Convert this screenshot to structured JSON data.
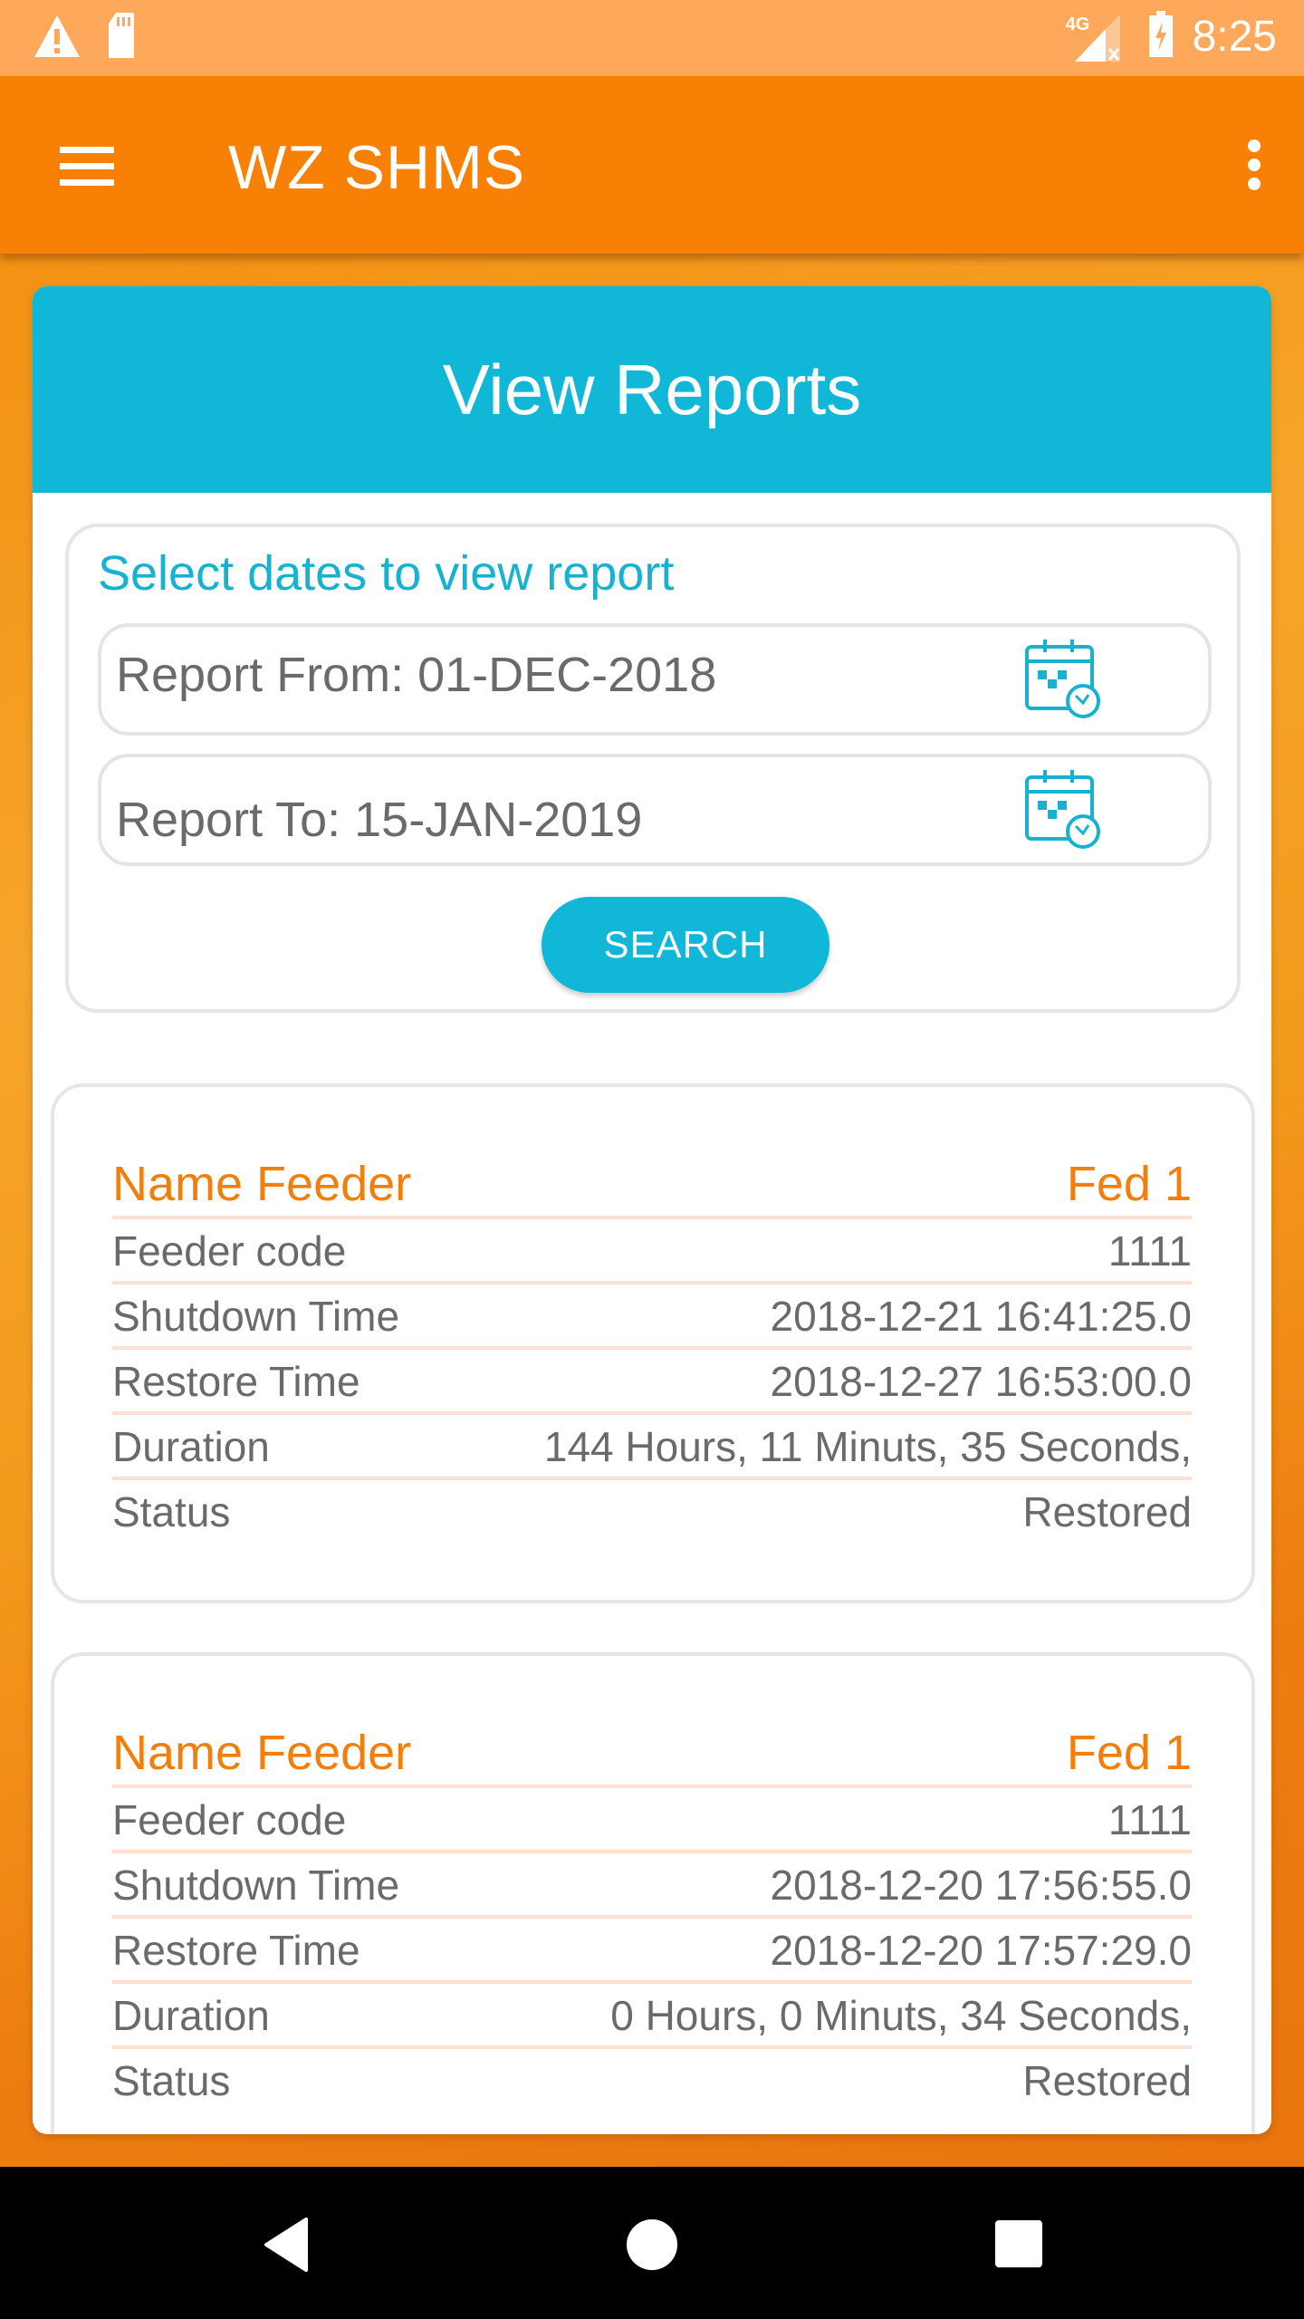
{
  "status_bar": {
    "left_icons": [
      "warning-icon",
      "sd-card-icon"
    ],
    "network_label": "4G",
    "right_icons": [
      "signal-no-data-icon",
      "battery-charging-icon"
    ],
    "time": "8:25"
  },
  "app_bar": {
    "title": "WZ SHMS",
    "menu_icon": "hamburger-menu-icon",
    "overflow_icon": "more-vert-icon"
  },
  "page": {
    "header": "View Reports",
    "date_panel": {
      "title": "Select dates to view report",
      "from_field": "Report From: 01-DEC-2018",
      "to_field": "Report To: 15-JAN-2019",
      "calendar_icon": "calendar-clock-icon",
      "search_label": "SEARCH"
    },
    "reports": [
      {
        "header_label": "Name Feeder",
        "header_value": "Fed 1",
        "rows": [
          {
            "label": "Feeder code",
            "value": "1111"
          },
          {
            "label": "Shutdown Time",
            "value": "2018-12-21 16:41:25.0"
          },
          {
            "label": "Restore Time",
            "value": "2018-12-27 16:53:00.0"
          },
          {
            "label": "Duration",
            "value": "144 Hours, 11 Minuts, 35 Seconds,"
          },
          {
            "label": "Status",
            "value": "Restored"
          }
        ]
      },
      {
        "header_label": "Name Feeder",
        "header_value": "Fed 1",
        "rows": [
          {
            "label": "Feeder code",
            "value": "1111"
          },
          {
            "label": "Shutdown Time",
            "value": "2018-12-20 17:56:55.0"
          },
          {
            "label": "Restore Time",
            "value": "2018-12-20 17:57:29.0"
          },
          {
            "label": "Duration",
            "value": "0 Hours, 0 Minuts, 34 Seconds,"
          },
          {
            "label": "Status",
            "value": "Restored"
          }
        ]
      }
    ]
  },
  "nav_bar": {
    "back_icon": "back-icon",
    "home_icon": "home-icon",
    "recents_icon": "recents-icon"
  },
  "colors": {
    "app_bar": "#f88004",
    "status_bar": "#fda85a",
    "accent_cyan": "#10b7d6",
    "feeder_orange": "#f27f0c",
    "text_gray": "#6a6a6a",
    "divider": "#fce0d2"
  }
}
